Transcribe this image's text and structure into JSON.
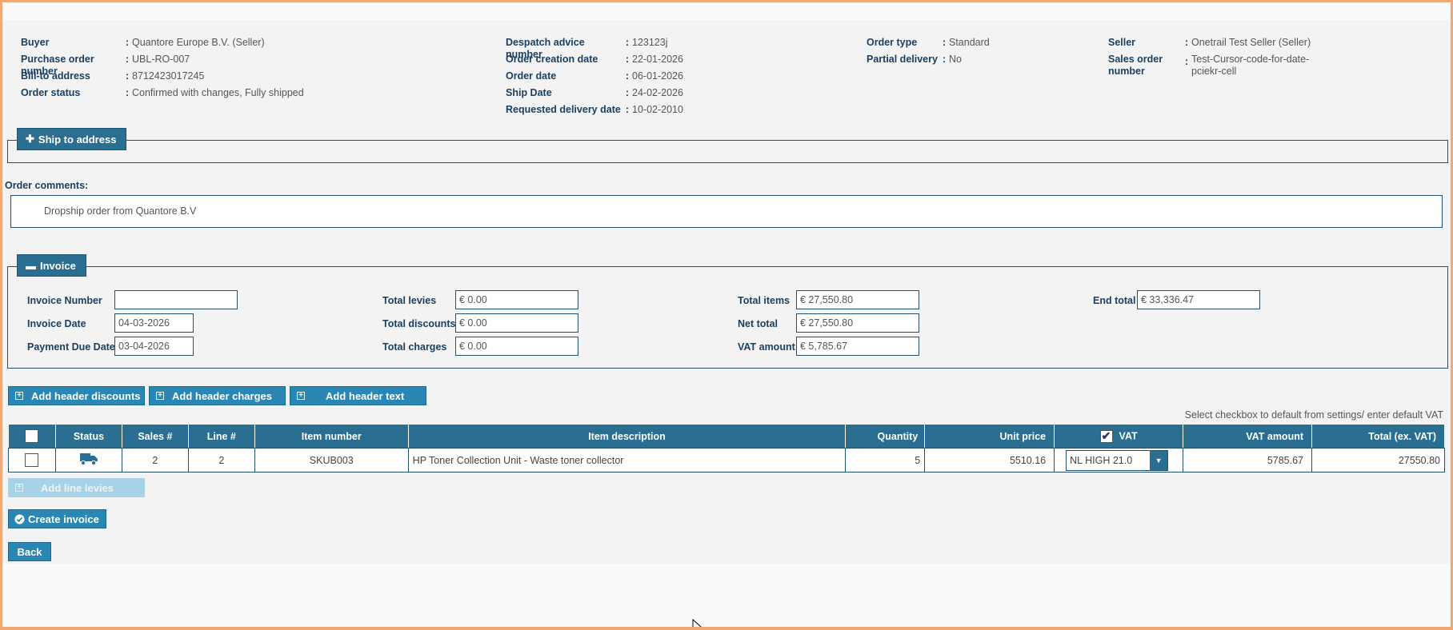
{
  "header": {
    "col1": [
      {
        "label": "Buyer",
        "value": "Quantore Europe B.V. (Seller)"
      },
      {
        "label": "Purchase order number",
        "value": "UBL-RO-007"
      },
      {
        "label": "Bill-to address",
        "value": "8712423017245"
      },
      {
        "label": "Order status",
        "value": "Confirmed with changes, Fully shipped"
      }
    ],
    "col2": [
      {
        "label": "Despatch advice number",
        "value": "123123j"
      },
      {
        "label": "Order creation date",
        "value": "22-01-2026"
      },
      {
        "label": "Order date",
        "value": "06-01-2026"
      },
      {
        "label": "Ship Date",
        "value": "24-02-2026"
      },
      {
        "label": "Requested delivery date",
        "value": "10-02-2010"
      }
    ],
    "col3": [
      {
        "label": "Order type",
        "value": "Standard"
      },
      {
        "label": "Partial delivery",
        "value": "No"
      }
    ],
    "col4": {
      "seller_label": "Seller",
      "seller_value": "Onetrail Test Seller (Seller)",
      "sales_order_label_1": "Sales order",
      "sales_order_label_2": "number",
      "sales_order_value_1": "Test-Cursor-code-for-date-",
      "sales_order_value_2": "pciekr-cell"
    }
  },
  "ship_to": {
    "label": "Ship to address",
    "icon": "plus-icon"
  },
  "order_comments": {
    "label": "Order comments:",
    "text": "Dropship order from Quantore B.V"
  },
  "invoice": {
    "legend": "Invoice",
    "invoice_number_label": "Invoice Number",
    "invoice_number_value": "",
    "invoice_date_label": "Invoice Date",
    "invoice_date_value": "04-03-2026",
    "payment_due_label": "Payment Due Date",
    "payment_due_value": "03-04-2026",
    "total_levies_label": "Total levies",
    "total_levies_value": "€ 0.00",
    "total_discounts_label": "Total discounts",
    "total_discounts_value": "€ 0.00",
    "total_charges_label": "Total charges",
    "total_charges_value": "€ 0.00",
    "total_items_label": "Total items",
    "total_items_value": "€ 27,550.80",
    "net_total_label": "Net total",
    "net_total_value": "€ 27,550.80",
    "vat_amount_label": "VAT amount",
    "vat_amount_value": "€ 5,785.67",
    "end_total_label": "End total",
    "end_total_value": "€ 33,336.47"
  },
  "actions": {
    "add_header_discounts": "Add header discounts",
    "add_header_charges": "Add header charges",
    "add_header_text": "Add header text",
    "add_line_levies": "Add line levies",
    "create_invoice": "Create invoice",
    "back": "Back"
  },
  "vat_note": "Select checkbox to default from settings/ enter default VAT",
  "table": {
    "columns": {
      "status": "Status",
      "sales": "Sales #",
      "line": "Line #",
      "item_number": "Item number",
      "item_description": "Item description",
      "quantity": "Quantity",
      "unit_price": "Unit price",
      "vat": "VAT",
      "vat_amount": "VAT amount",
      "total": "Total (ex. VAT)"
    },
    "rows": [
      {
        "status_icon": "truck-icon",
        "sales": "2",
        "line": "2",
        "item_number": "SKUB003",
        "item_description": "HP Toner Collection Unit - Waste toner collector",
        "quantity": "5",
        "unit_price": "5510.16",
        "vat": "NL HIGH 21.0",
        "vat_amount": "5785.67",
        "total": "27550.80"
      }
    ]
  },
  "colors": {
    "accent": "#2a6f92",
    "button": "#2a86b2",
    "label": "#1b3f60",
    "frame": "#f0a875"
  }
}
